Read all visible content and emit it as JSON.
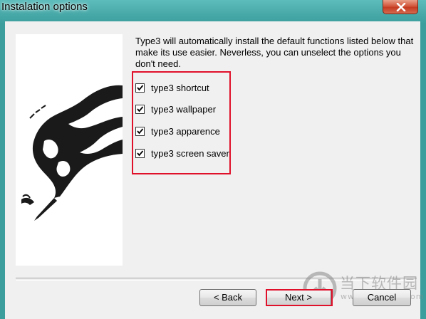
{
  "window": {
    "title": "Instalation options"
  },
  "description": "Type3 will automatically install the default functions listed below that make its use easier. Neverless, you can unselect the options you don't need.",
  "options": [
    {
      "label": "type3 shortcut",
      "checked": true
    },
    {
      "label": "type3 wallpaper",
      "checked": true
    },
    {
      "label": "type3 apparence",
      "checked": true
    },
    {
      "label": "type3 screen saver",
      "checked": true
    }
  ],
  "buttons": {
    "back": "< Back",
    "next": "Next >",
    "cancel": "Cancel"
  },
  "watermark": {
    "text": "当下软件园",
    "url": "www.downxia.com"
  },
  "colors": {
    "highlight": "#e0102a",
    "title_bar": "#3c9e9d"
  }
}
